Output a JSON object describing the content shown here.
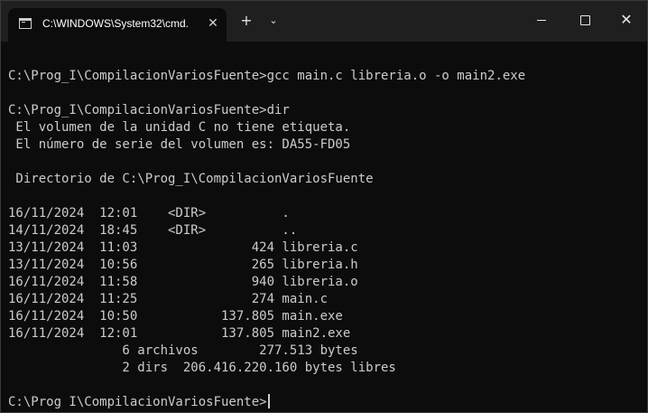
{
  "window": {
    "tab_title": "C:\\WINDOWS\\System32\\cmd.",
    "tab_close": "✕",
    "new_tab": "+",
    "dropdown": "⌄",
    "close": "✕"
  },
  "console": {
    "lines": [
      "",
      "C:\\Prog_I\\CompilacionVariosFuente>gcc main.c libreria.o -o main2.exe",
      "",
      "C:\\Prog_I\\CompilacionVariosFuente>dir",
      " El volumen de la unidad C no tiene etiqueta.",
      " El número de serie del volumen es: DA55-FD05",
      "",
      " Directorio de C:\\Prog_I\\CompilacionVariosFuente",
      "",
      "16/11/2024  12:01    <DIR>          .",
      "14/11/2024  18:45    <DIR>          ..",
      "13/11/2024  11:03               424 libreria.c",
      "13/11/2024  10:56               265 libreria.h",
      "16/11/2024  11:58               940 libreria.o",
      "16/11/2024  11:25               274 main.c",
      "16/11/2024  10:50           137.805 main.exe",
      "16/11/2024  12:01           137.805 main2.exe",
      "               6 archivos        277.513 bytes",
      "               2 dirs  206.416.220.160 bytes libres",
      ""
    ],
    "prompt": "C:\\Prog_I\\CompilacionVariosFuente>"
  },
  "colors": {
    "background": "#0c0c0c",
    "titlebar": "#1f1f1f",
    "text": "#cccccc"
  },
  "icons": [
    "terminal-icon",
    "close-icon",
    "plus-icon",
    "chevron-down-icon",
    "minimize-icon",
    "maximize-icon"
  ]
}
